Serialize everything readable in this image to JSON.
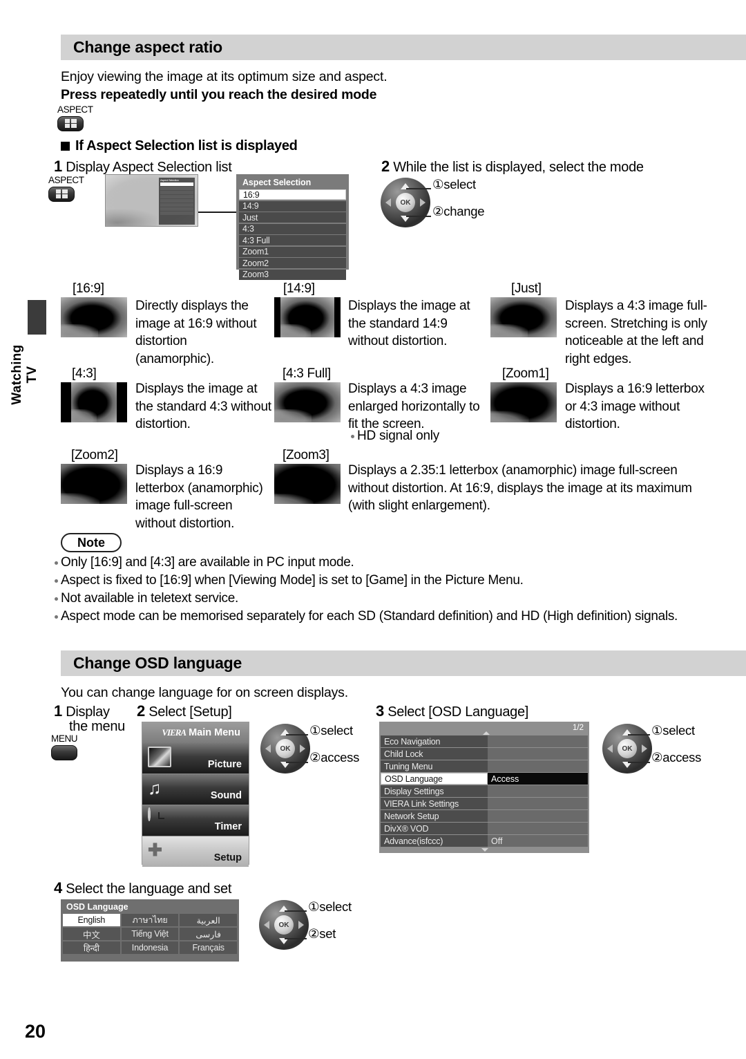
{
  "sidebar": {
    "chapter_label": "Watching TV"
  },
  "page_number": "20",
  "section1": {
    "title": "Change aspect ratio",
    "intro": "Enjoy viewing the image at its optimum size and aspect.",
    "press_line": "Press repeatedly until you reach the desired mode",
    "aspect_button_label": "ASPECT",
    "subhead": "If Aspect Selection list is displayed",
    "step1": {
      "num": "1",
      "text": "Display Aspect Selection list",
      "button_label": "ASPECT"
    },
    "step2": {
      "num": "2",
      "text": "While the list is displayed, select the mode",
      "callout1": "①select",
      "callout2": "②change",
      "ok_label": "OK"
    },
    "aspect_panel": {
      "title": "Aspect Selection",
      "items": [
        "16:9",
        "14:9",
        "Just",
        "4:3",
        "4:3 Full",
        "Zoom1",
        "Zoom2",
        "Zoom3"
      ],
      "selected_index": 0
    },
    "modes": [
      {
        "tag": "[16:9]",
        "desc": "Directly displays the image at 16:9 without distortion (anamorphic)."
      },
      {
        "tag": "[14:9]",
        "desc": "Displays the image at the standard 14:9 without distortion."
      },
      {
        "tag": "[Just]",
        "desc": "Displays a 4:3 image full-screen. Stretching is only noticeable at the left and right edges."
      },
      {
        "tag": "[4:3]",
        "desc": "Displays the image at the standard 4:3 without distortion."
      },
      {
        "tag": "[4:3 Full]",
        "desc": "Displays a 4:3 image enlarged horizontally to fit the screen.",
        "note": "HD signal only"
      },
      {
        "tag": "[Zoom1]",
        "desc": "Displays a 16:9 letterbox or 4:3 image without distortion."
      },
      {
        "tag": "[Zoom2]",
        "desc": "Displays a 16:9 letterbox (anamorphic) image full-screen without distortion."
      },
      {
        "tag": "[Zoom3]",
        "desc": "Displays a 2.35:1 letterbox (anamorphic) image full-screen without distortion. At 16:9, displays the image at its maximum (with slight enlargement)."
      }
    ],
    "note": {
      "label": "Note",
      "items": [
        "Only [16:9] and [4:3] are available in PC input mode.",
        "Aspect is fixed to [16:9] when [Viewing Mode] is set to [Game] in the Picture Menu.",
        "Not available in teletext service.",
        "Aspect mode can be memorised separately for each SD (Standard definition) and HD (High definition) signals."
      ]
    }
  },
  "section2": {
    "title": "Change OSD language",
    "intro": "You can change language for on screen displays.",
    "step1": {
      "num": "1",
      "line1": "Display",
      "line2": "the menu",
      "button_label": "MENU"
    },
    "step2": {
      "num": "2",
      "text": "Select [Setup]",
      "callout1": "①select",
      "callout2": "②access",
      "ok_label": "OK"
    },
    "step3": {
      "num": "3",
      "text": "Select [OSD Language]",
      "callout1": "①select",
      "callout2": "②access",
      "ok_label": "OK"
    },
    "step4": {
      "num": "4",
      "text": "Select the language and set",
      "callout1": "①select",
      "callout2": "②set",
      "ok_label": "OK"
    },
    "main_menu": {
      "brand": "VIERA",
      "title": "Main Menu",
      "items": [
        {
          "label": "Picture",
          "icon": "picture-icon",
          "active": false
        },
        {
          "label": "Sound",
          "icon": "sound-icon",
          "active": false
        },
        {
          "label": "Timer",
          "icon": "timer-icon",
          "active": false
        },
        {
          "label": "Setup",
          "icon": "setup-icon",
          "active": true
        }
      ]
    },
    "setup_menu": {
      "page_indicator": "1/2",
      "rows": [
        {
          "key": "Eco Navigation",
          "value": "",
          "selected": false
        },
        {
          "key": "Child Lock",
          "value": "",
          "selected": false
        },
        {
          "key": "Tuning Menu",
          "value": "",
          "selected": false
        },
        {
          "key": "OSD Language",
          "value": "Access",
          "selected": true
        },
        {
          "key": "Display Settings",
          "value": "",
          "selected": false
        },
        {
          "key": "VIERA Link Settings",
          "value": "",
          "selected": false
        },
        {
          "key": "Network Setup",
          "value": "",
          "selected": false
        },
        {
          "key": "DivX® VOD",
          "value": "",
          "selected": false
        },
        {
          "key": "Advance(isfccc)",
          "value": "Off",
          "selected": false
        }
      ]
    },
    "osd_language": {
      "title": "OSD Language",
      "rows": [
        [
          {
            "label": "English",
            "selected": true
          },
          {
            "label": "ภาษาไทย",
            "selected": false
          },
          {
            "label": "العربية",
            "selected": false
          }
        ],
        [
          {
            "label": "中文",
            "selected": false
          },
          {
            "label": "Tiếng Việt",
            "selected": false
          },
          {
            "label": "فارسی",
            "selected": false
          }
        ],
        [
          {
            "label": "हिन्दी",
            "selected": false
          },
          {
            "label": "Indonesia",
            "selected": false
          },
          {
            "label": "Français",
            "selected": false
          }
        ]
      ]
    }
  },
  "colors": {
    "header_bg": "#d2d2d2",
    "osd_panel": "#7b7b7b",
    "osd_row": "#4a4a4a",
    "selected": "#ffffff"
  }
}
